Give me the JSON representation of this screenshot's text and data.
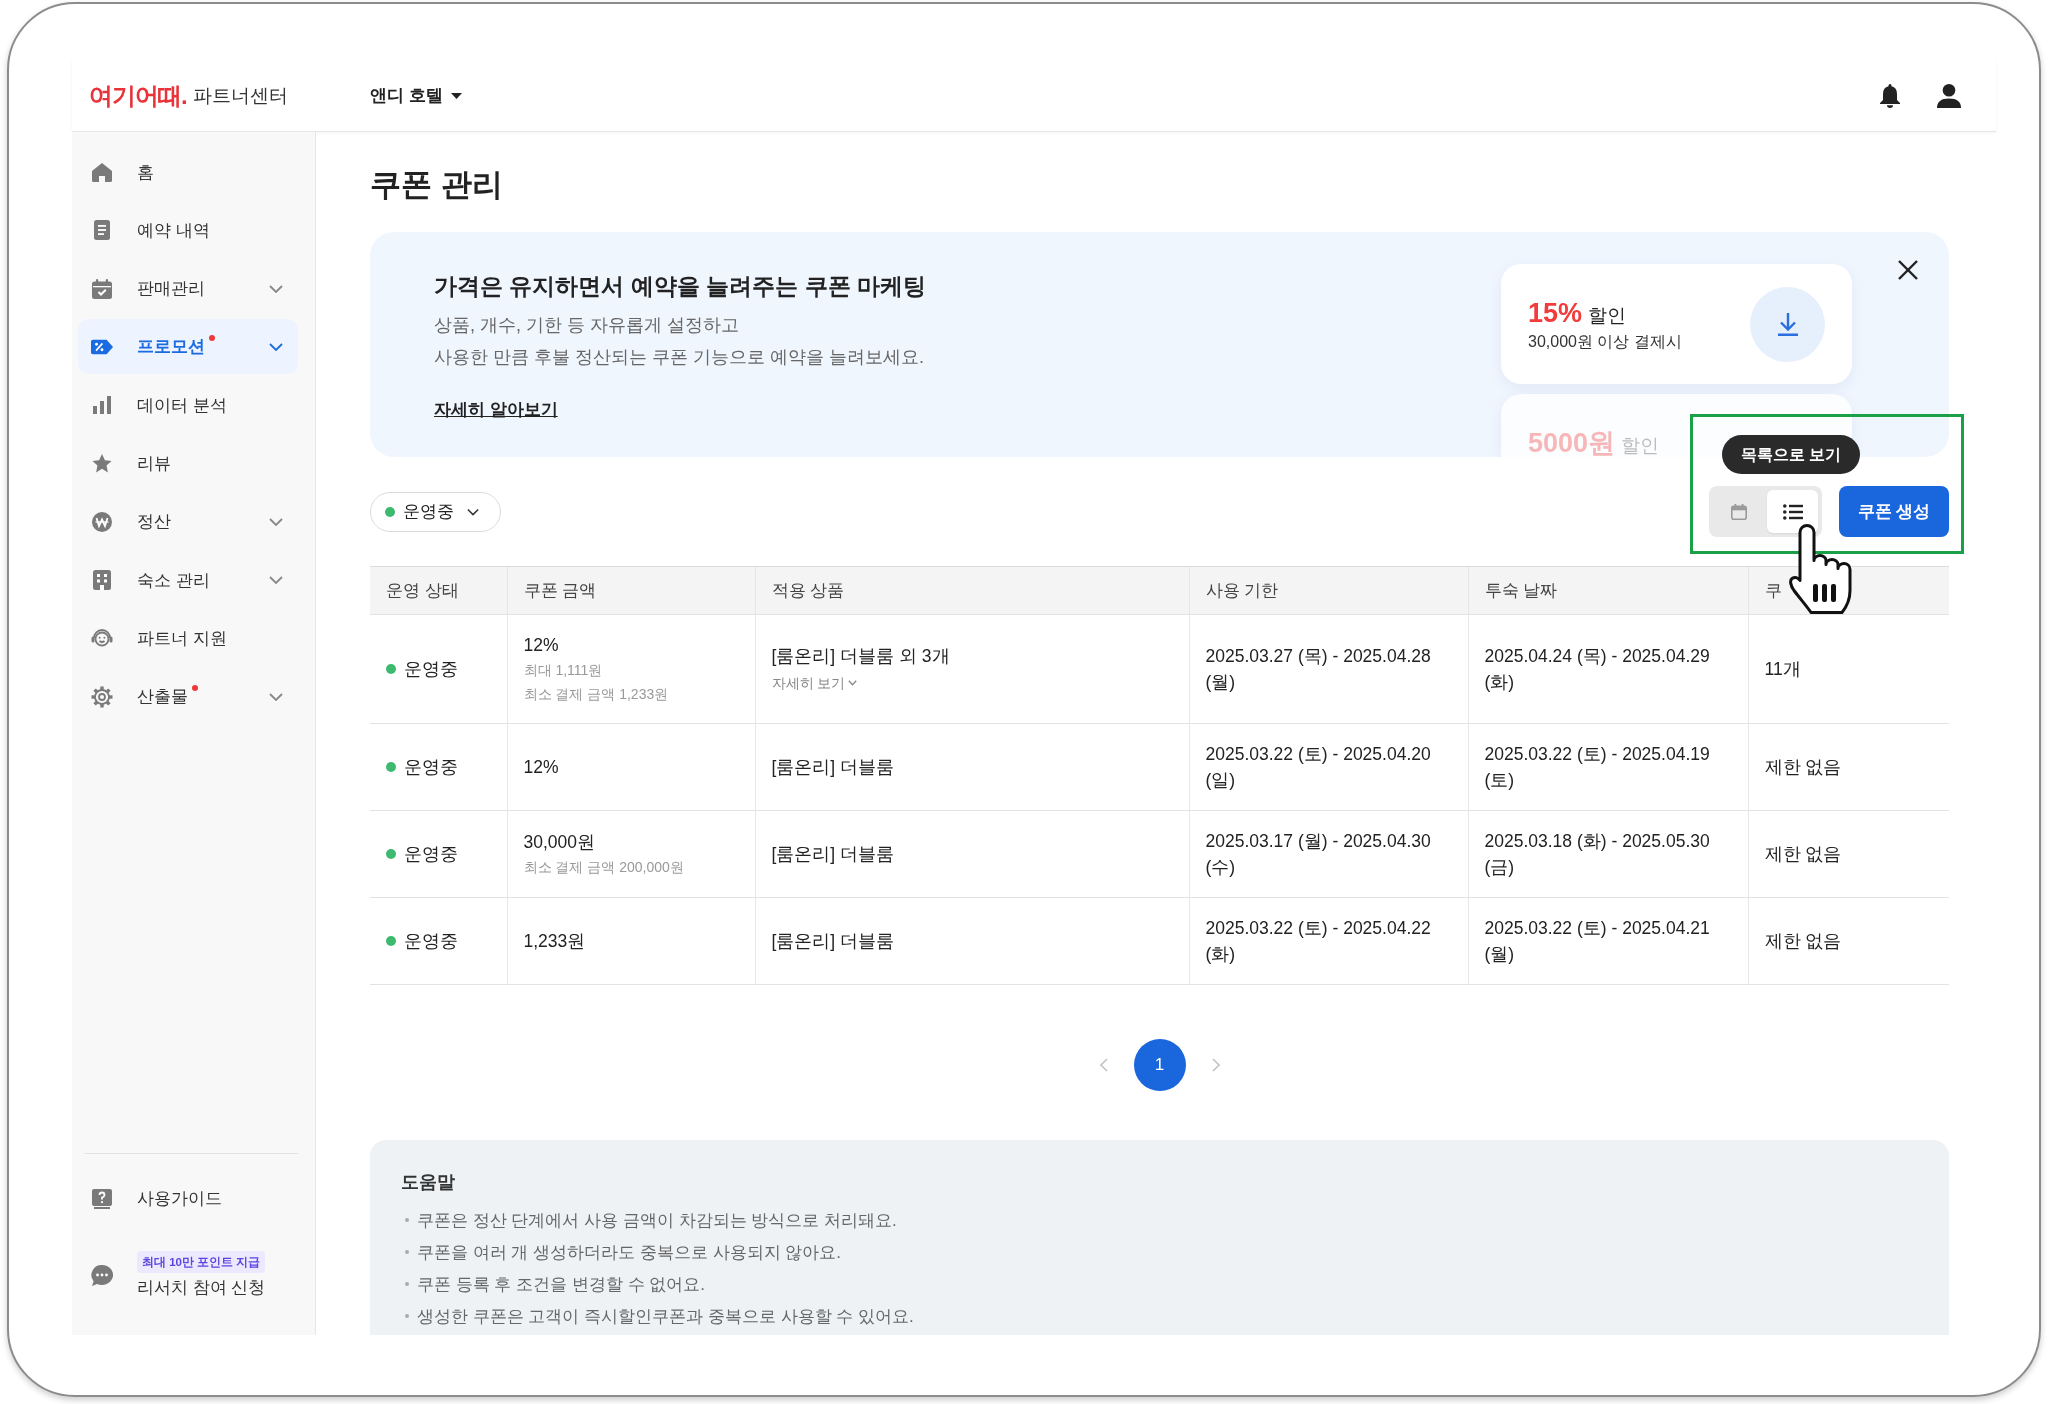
{
  "header": {
    "logo": "여기어때.",
    "logo_suffix": "파트너센터",
    "property_selector": "앤디 호텔"
  },
  "sidebar": {
    "items": [
      {
        "label": "홈",
        "selected": false,
        "has_submenu": false,
        "new": false
      },
      {
        "label": "예약 내역",
        "selected": false,
        "has_submenu": false,
        "new": false
      },
      {
        "label": "판매관리",
        "selected": false,
        "has_submenu": true,
        "new": false
      },
      {
        "label": "프로모션",
        "selected": true,
        "has_submenu": true,
        "new": true
      },
      {
        "label": "데이터 분석",
        "selected": false,
        "has_submenu": false,
        "new": false
      },
      {
        "label": "리뷰",
        "selected": false,
        "has_submenu": false,
        "new": false
      },
      {
        "label": "정산",
        "selected": false,
        "has_submenu": true,
        "new": false
      },
      {
        "label": "숙소 관리",
        "selected": false,
        "has_submenu": true,
        "new": false
      },
      {
        "label": "파트너 지원",
        "selected": false,
        "has_submenu": false,
        "new": false
      },
      {
        "label": "산출물",
        "selected": false,
        "has_submenu": true,
        "new": true
      }
    ],
    "guide": "사용가이드",
    "research": {
      "badge": "최대 10만 포인트 지급",
      "label": "리서치 참여 신청"
    }
  },
  "page_title": "쿠폰 관리",
  "banner": {
    "title": "가격은 유지하면서 예약을 늘려주는 쿠폰 마케팅",
    "lines": [
      "상품, 개수, 기한 등 자유롭게 설정하고",
      "사용한 만큼 후불 정산되는 쿠폰 기능으로 예약을 늘려보세요."
    ],
    "link": "자세히 알아보기",
    "coupons": [
      {
        "amount": "15%",
        "label": "할인",
        "condition": "30,000원 이상 결제시",
        "download_button": true,
        "dimmed": false
      },
      {
        "amount": "5000원",
        "label": "할인",
        "download_button": false,
        "dimmed": true
      }
    ]
  },
  "filter": {
    "label": "운영중",
    "color": "#3dba6f"
  },
  "view_toggle": {
    "tooltip": "목록으로 보기",
    "options": [
      {
        "kind": "calendar",
        "selected": false
      },
      {
        "kind": "list",
        "selected": true
      }
    ]
  },
  "create_button": "쿠폰 생성",
  "table": {
    "columns": [
      "운영 상태",
      "쿠폰 금액",
      "적용 상품",
      "사용 기한",
      "투숙 날짜",
      "쿠"
    ],
    "rows": [
      {
        "status": "운영중",
        "color": "#3dba6f",
        "amount": "12%",
        "amount_notes": [
          "최대 1,111원",
          "최소 결제 금액 1,233원"
        ],
        "product": "[룸온리] 더블룸 외 3개",
        "product_link": "자세히 보기",
        "usage_period": "2025.03.27 (목) - 2025.04.28 (월)",
        "stay_dates": "2025.04.24 (목) - 2025.04.29 (화)",
        "column_6": "11개"
      },
      {
        "status": "운영중",
        "color": "#3dba6f",
        "amount": "12%",
        "product": "[룸온리] 더블룸",
        "usage_period": "2025.03.22 (토) - 2025.04.20 (일)",
        "stay_dates": "2025.03.22 (토) - 2025.04.19 (토)",
        "column_6": "제한 없음"
      },
      {
        "status": "운영중",
        "color": "#3dba6f",
        "amount": "30,000원",
        "amount_notes": [
          "최소 결제 금액 200,000원"
        ],
        "product": "[룸온리] 더블룸",
        "usage_period": "2025.03.17 (월) - 2025.04.30 (수)",
        "stay_dates": "2025.03.18 (화) - 2025.05.30 (금)",
        "column_6": "제한 없음"
      },
      {
        "status": "운영중",
        "color": "#3dba6f",
        "amount": "1,233원",
        "product": "[룸온리] 더블룸",
        "usage_period": "2025.03.22 (토) - 2025.04.22 (화)",
        "stay_dates": "2025.03.22 (토) - 2025.04.21 (월)",
        "column_6": "제한 없음"
      }
    ]
  },
  "pagination": {
    "pages": [
      {
        "label": "1",
        "selected": true
      }
    ]
  },
  "help": {
    "title": "도움말",
    "items": [
      "쿠폰은 정산 단계에서 사용 금액이 차감되는 방식으로 처리돼요.",
      "쿠폰을 여러 개 생성하더라도 중복으로 사용되지 않아요.",
      "쿠폰 등록 후 조건을 변경할 수 없어요.",
      "생성한 쿠폰은 고객이 즉시할인쿠폰과 중복으로 사용할 수 있어요."
    ]
  }
}
